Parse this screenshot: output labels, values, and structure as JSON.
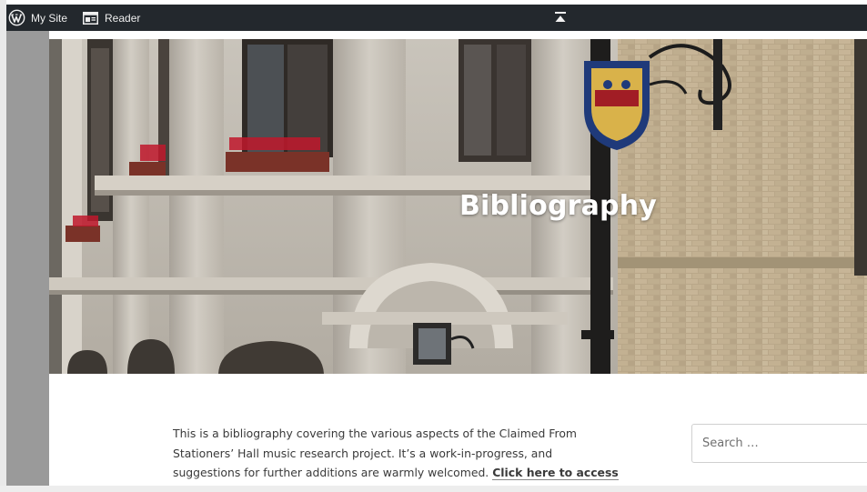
{
  "adminbar": {
    "my_site_label": "My Site",
    "reader_label": "Reader"
  },
  "hero": {
    "title": "Bibliography"
  },
  "content": {
    "intro_text": "This is a bibliography covering the various aspects of the Claimed From Stationers’ Hall music research project.  It’s a work-in-progress, and suggestions for further additions are warmly welcomed.",
    "link_label": "Click here to access"
  },
  "sidebar": {
    "search_placeholder": "Search …"
  },
  "colors": {
    "adminbar_bg": "#23282d",
    "hero_title": "#ffffff",
    "body_text": "#3a3a3a"
  },
  "icons": [
    "wordpress-logo-icon",
    "reader-icon",
    "collapse-toggle-icon"
  ]
}
